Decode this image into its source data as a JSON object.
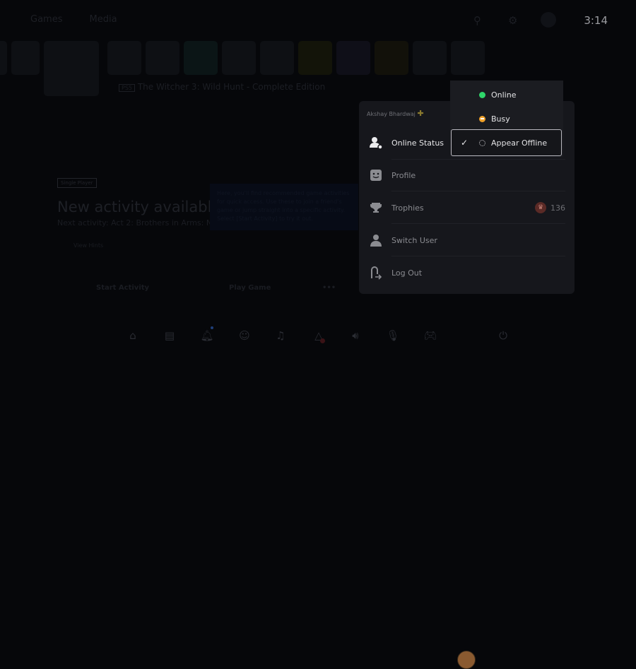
{
  "header": {
    "tabs": [
      "Games",
      "Media"
    ],
    "clock": "3:14",
    "icons": [
      "search-icon",
      "gear-icon",
      "avatar-icon"
    ]
  },
  "game": {
    "platform_badge": "PS5",
    "title": "The Witcher 3: Wild Hunt - Complete Edition"
  },
  "activity": {
    "badge": "Single Player",
    "headline": "New activity available",
    "subtitle": "Next activity: Act 2: Brothers in Arms: Novigrad",
    "hints": "View Hints",
    "tooltip": "Here, you'll find recommended game activities for quick access. Use these to join a friend's game or jump straight into a specific activity. Select [Start Activity] to try it out.",
    "buttons": [
      "Start Activity",
      "Play Game",
      "•••"
    ]
  },
  "profile_menu": {
    "user": "Akshay Bhardwaj",
    "items": [
      {
        "label": "Online Status",
        "icon": "online-status-icon"
      },
      {
        "label": "Profile",
        "icon": "profile-face-icon"
      },
      {
        "label": "Trophies",
        "icon": "trophy-icon",
        "value": "136"
      },
      {
        "label": "Switch User",
        "icon": "user-icon"
      },
      {
        "label": "Log Out",
        "icon": "logout-icon"
      }
    ]
  },
  "status_menu": {
    "options": [
      {
        "label": "Online",
        "color": "#2fd66a"
      },
      {
        "label": "Busy",
        "color": "#f0a12a"
      },
      {
        "label": "Appear Offline",
        "color": "#cfcfd3",
        "selected": true
      }
    ]
  },
  "control_bar": {
    "icons": [
      "home-icon",
      "game-base-icon",
      "notifications-icon",
      "game-base-friends-icon",
      "music-icon",
      "accessibility-icon",
      "sound-icon",
      "mic-muted-icon",
      "controller-icon",
      "avatar",
      "power-icon"
    ]
  }
}
